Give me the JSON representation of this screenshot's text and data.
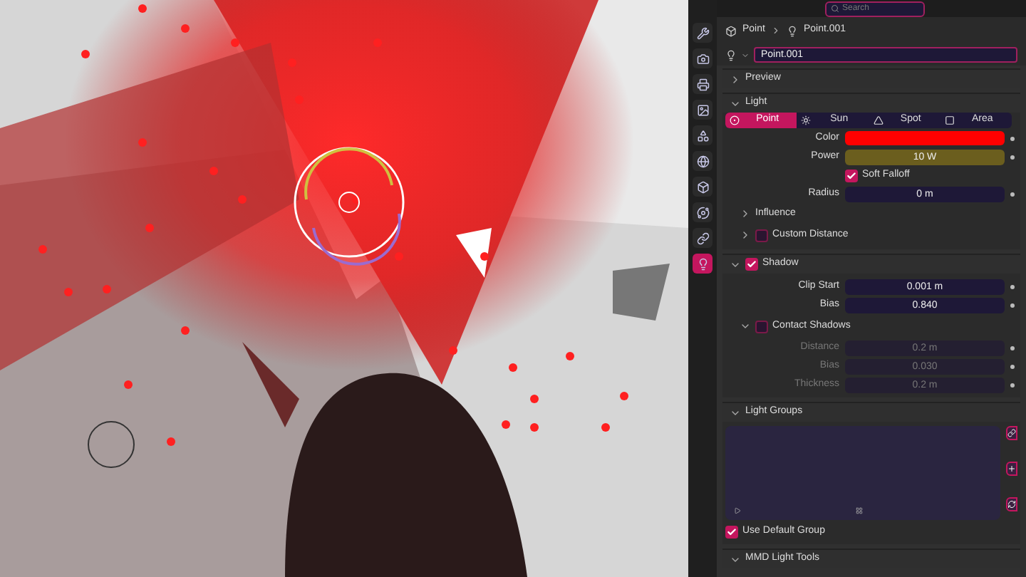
{
  "header": {
    "search_placeholder": "Search"
  },
  "sidebar_tabs": [
    {
      "selected": false
    },
    {
      "selected": false
    },
    {
      "selected": false
    },
    {
      "selected": false
    },
    {
      "selected": false
    },
    {
      "selected": false
    },
    {
      "selected": false
    },
    {
      "selected": false
    },
    {
      "selected": false
    },
    {
      "selected": true
    }
  ],
  "breadcrumb": [
    "Point",
    "Point.001"
  ],
  "datablock": {
    "name": "Point.001"
  },
  "preview": {
    "title": "Preview",
    "expanded": false
  },
  "light": {
    "title": "Light",
    "expanded": true,
    "types": [
      {
        "label": "Point",
        "selected": true
      },
      {
        "label": "Sun",
        "selected": false
      },
      {
        "label": "Spot",
        "selected": false
      },
      {
        "label": "Area",
        "selected": false
      }
    ],
    "color": {
      "label": "Color",
      "color": "#ff0000"
    },
    "power": {
      "label": "Power",
      "value": "10 W"
    },
    "soft_falloff": {
      "label": "Soft Falloff",
      "checked": true
    },
    "radius": {
      "label": "Radius",
      "value": "0 m"
    },
    "influence": {
      "label": "Influence",
      "expanded": false
    },
    "custom_distance": {
      "label": "Custom Distance",
      "expanded": false,
      "checked": false
    }
  },
  "shadow": {
    "title": "Shadow",
    "expanded": true,
    "checked": true,
    "fields": [
      {
        "label": "Clip Start",
        "value": "0.001 m"
      },
      {
        "label": "Bias",
        "value": "0.840"
      }
    ],
    "contact_shadows": {
      "label": "Contact Shadows",
      "expanded": true,
      "checked": false,
      "fields": [
        {
          "label": "Distance",
          "value": "0.2 m",
          "disabled": true
        },
        {
          "label": "Bias",
          "value": "0.030",
          "disabled": true
        },
        {
          "label": "Thickness",
          "value": "0.2 m",
          "disabled": true
        }
      ]
    }
  },
  "light_groups": {
    "title": "Light Groups",
    "expanded": true,
    "use_default_group": {
      "label": "Use Default Group",
      "checked": true
    }
  },
  "mmd": {
    "title": "MMD Light Tools",
    "expanded": true
  }
}
